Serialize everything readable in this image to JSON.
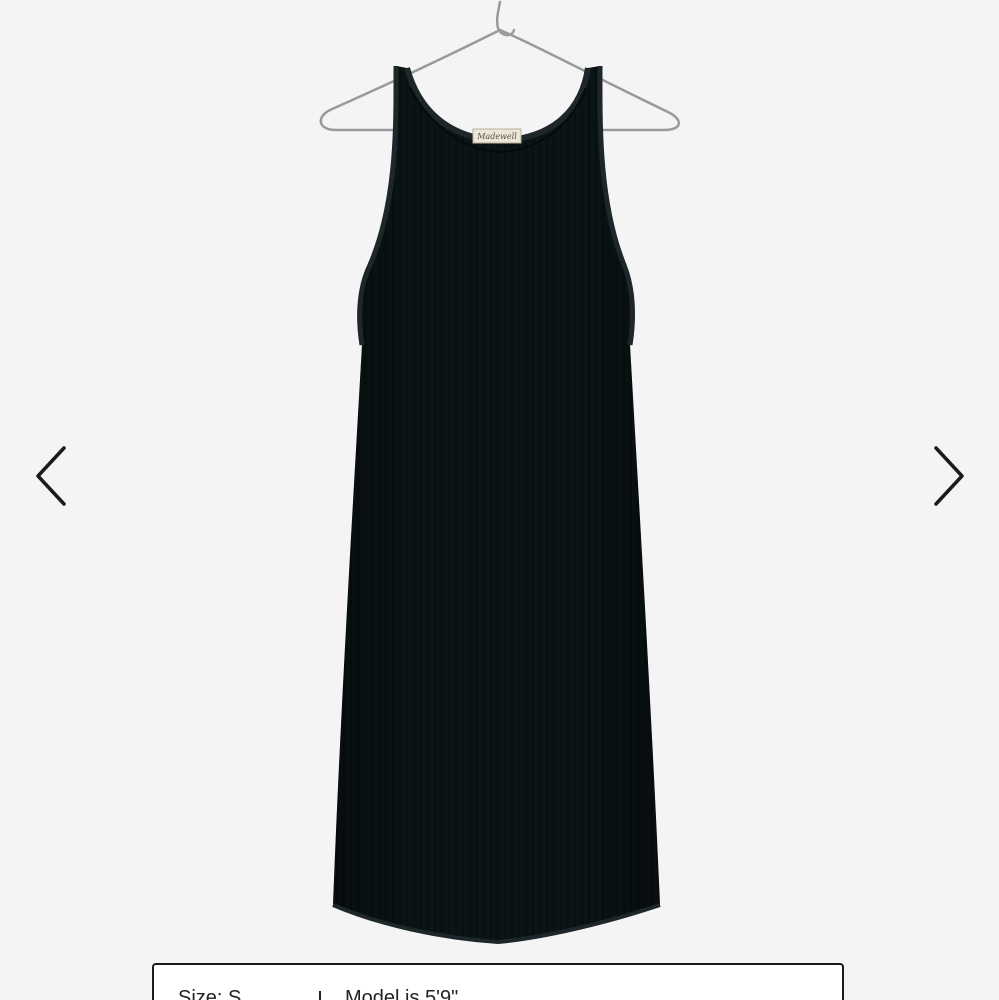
{
  "gallery": {
    "product_image_alt": "Black ribbed sleeveless high-neck tank dress on a wire hanger",
    "prev_icon": "chevron-left-icon",
    "next_icon": "chevron-right-icon",
    "label_brand_text": "Madewell"
  },
  "details_panel": {
    "size_text": "Size: S",
    "model_text": "Model is 5'9\""
  },
  "colors": {
    "background": "#f4f4f4",
    "dress": "#0c1416",
    "arrow": "#1a1a1a",
    "panel_border": "#1a1a1a"
  }
}
